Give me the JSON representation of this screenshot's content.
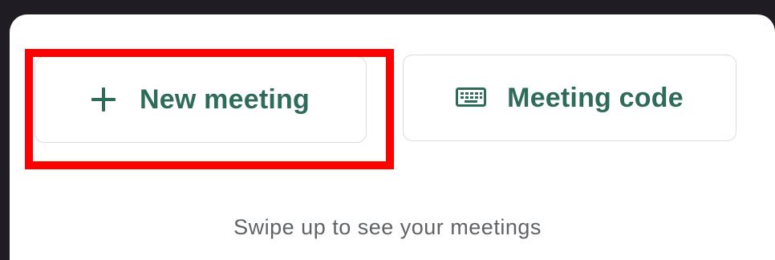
{
  "actions": {
    "new_meeting_label": "New meeting",
    "meeting_code_label": "Meeting code"
  },
  "hint_text": "Swipe up to see your meetings",
  "icons": {
    "new_meeting": "plus-icon",
    "meeting_code": "keyboard-icon"
  },
  "colors": {
    "accent_text": "#2f6b5a",
    "highlight": "#ff0000",
    "hint_text": "#5f6368",
    "top_bar": "#1f1c24"
  }
}
